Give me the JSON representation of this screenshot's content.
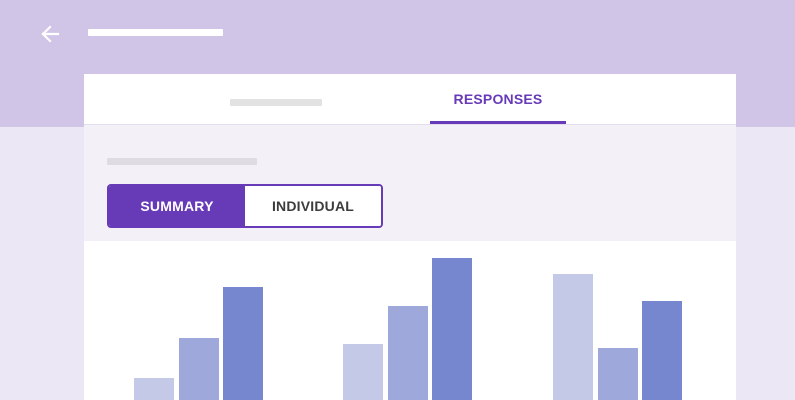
{
  "header": {
    "back_icon": "arrow-left-icon"
  },
  "tabs": {
    "active_label": "RESPONSES"
  },
  "response_view": {
    "summary_label": "SUMMARY",
    "individual_label": "INDIVIDUAL",
    "selected": "SUMMARY"
  },
  "colors": {
    "accent": "#673ab7",
    "header_bg": "#d0c4e7",
    "bar_light": "#c5c9e8",
    "bar_medium": "#9ea8db",
    "bar_dark": "#7687d0"
  },
  "chart_data": {
    "type": "bar",
    "groups": [
      {
        "bars": [
          {
            "value": 20,
            "shade": "light"
          },
          {
            "value": 55,
            "shade": "medium"
          },
          {
            "value": 101,
            "shade": "dark"
          }
        ]
      },
      {
        "bars": [
          {
            "value": 50,
            "shade": "light"
          },
          {
            "value": 84,
            "shade": "medium"
          },
          {
            "value": 126,
            "shade": "dark"
          }
        ]
      },
      {
        "bars": [
          {
            "value": 112,
            "shade": "light"
          },
          {
            "value": 46,
            "shade": "medium"
          },
          {
            "value": 88,
            "shade": "dark"
          }
        ]
      }
    ],
    "ylim": [
      0,
      130
    ]
  }
}
